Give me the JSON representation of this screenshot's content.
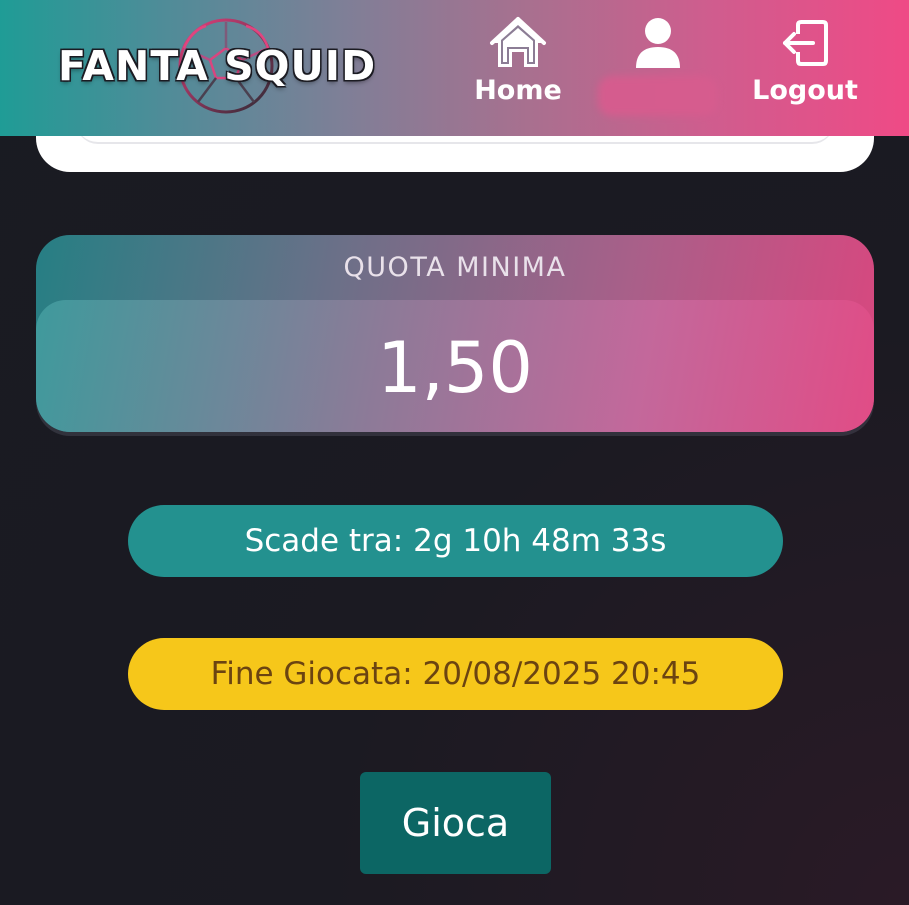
{
  "header": {
    "logo": {
      "text": "FANTA SQUID",
      "icon": "soccer-ball-icon"
    },
    "nav": {
      "home": {
        "label": "Home",
        "icon": "home-icon"
      },
      "profile": {
        "label": "",
        "icon": "user-icon"
      },
      "logout": {
        "label": "Logout",
        "icon": "logout-icon"
      }
    }
  },
  "quota": {
    "title": "QUOTA MINIMA",
    "value": "1,50"
  },
  "countdown": {
    "text": "Scade tra: 2g 10h 48m 33s"
  },
  "end_time": {
    "text": "Fine Giocata: 20/08/2025 20:45"
  },
  "play_button": {
    "label": "Gioca"
  },
  "colors": {
    "header_start": "#1f9c96",
    "header_end": "#ef4a86",
    "countdown_bg": "#23918f",
    "end_time_bg": "#f6c71a",
    "end_time_text": "#6b4411",
    "play_button_bg": "#0c6664",
    "page_bg": "#1b1a22"
  }
}
